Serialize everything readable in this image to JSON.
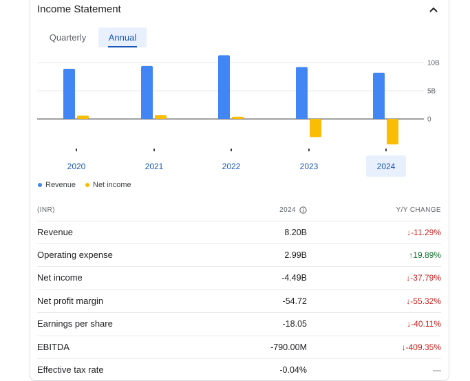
{
  "section": {
    "title": "Income Statement",
    "collapse_icon": "chevron-up-icon"
  },
  "tabs": [
    {
      "label": "Quarterly"
    },
    {
      "label": "Annual"
    }
  ],
  "active_tab": "Annual",
  "chart_data": {
    "type": "bar",
    "categories": [
      "2020",
      "2021",
      "2022",
      "2023",
      "2024"
    ],
    "selected_category": "2024",
    "series": [
      {
        "name": "Revenue",
        "color": "#4285f4",
        "values": [
          8.9,
          9.4,
          11.3,
          9.2,
          8.2
        ]
      },
      {
        "name": "Net income",
        "color": "#fbbc04",
        "values": [
          0.6,
          0.7,
          0.4,
          -3.2,
          -4.49
        ]
      }
    ],
    "y_ticks": [
      "10B",
      "5B",
      "0"
    ],
    "y_tick_values": [
      10,
      5,
      0
    ],
    "ylim": [
      -5,
      12
    ],
    "unit": "B"
  },
  "table": {
    "currency_label": "(INR)",
    "year_header": "2024",
    "change_header": "Y/Y CHANGE",
    "rows": [
      {
        "label": "Revenue",
        "value": "8.20B",
        "change": "-11.29%",
        "dir": "down"
      },
      {
        "label": "Operating expense",
        "value": "2.99B",
        "change": "19.89%",
        "dir": "up"
      },
      {
        "label": "Net income",
        "value": "-4.49B",
        "change": "-37.79%",
        "dir": "down"
      },
      {
        "label": "Net profit margin",
        "value": "-54.72",
        "change": "-55.32%",
        "dir": "down"
      },
      {
        "label": "Earnings per share",
        "value": "-18.05",
        "change": "-40.11%",
        "dir": "down"
      },
      {
        "label": "EBITDA",
        "value": "-790.00M",
        "change": "-409.35%",
        "dir": "down"
      },
      {
        "label": "Effective tax rate",
        "value": "-0.04%",
        "change": "—",
        "dir": "none"
      }
    ]
  }
}
